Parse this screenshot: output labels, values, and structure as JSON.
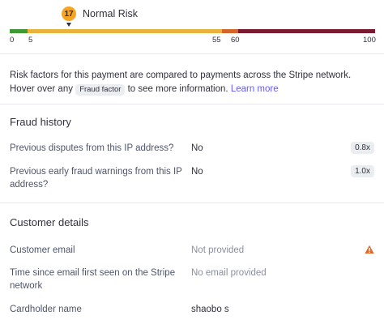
{
  "risk": {
    "score": "17",
    "label": "Normal Risk",
    "ticks": [
      "0",
      "5",
      "55",
      "60",
      "100"
    ],
    "colors": {
      "low": "#3f9a35",
      "normal": "#e8b23c",
      "elevated": "#d4652a",
      "high": "#7a1a2e"
    }
  },
  "description": {
    "text1": "Risk factors for this payment are compared to payments across the Stripe network. Hover over any ",
    "chip": "Fraud factor",
    "text2": " to see more information. ",
    "link": "Learn more"
  },
  "fraud_history": {
    "title": "Fraud history",
    "rows": [
      {
        "label": "Previous disputes from this IP address?",
        "value": "No",
        "multiplier": "0.8x"
      },
      {
        "label": "Previous early fraud warnings from this IP address?",
        "value": "No",
        "multiplier": "1.0x"
      }
    ]
  },
  "customer_details": {
    "title": "Customer details",
    "rows": [
      {
        "label": "Customer email",
        "value": "Not provided",
        "icon": "warning-icon"
      },
      {
        "label": "Time since email first seen on the Stripe network",
        "value": "No email provided"
      },
      {
        "label": "Cardholder name",
        "value": "shaobo s"
      }
    ]
  },
  "accent_color": "#635bff",
  "warning_color": "#e5662a"
}
